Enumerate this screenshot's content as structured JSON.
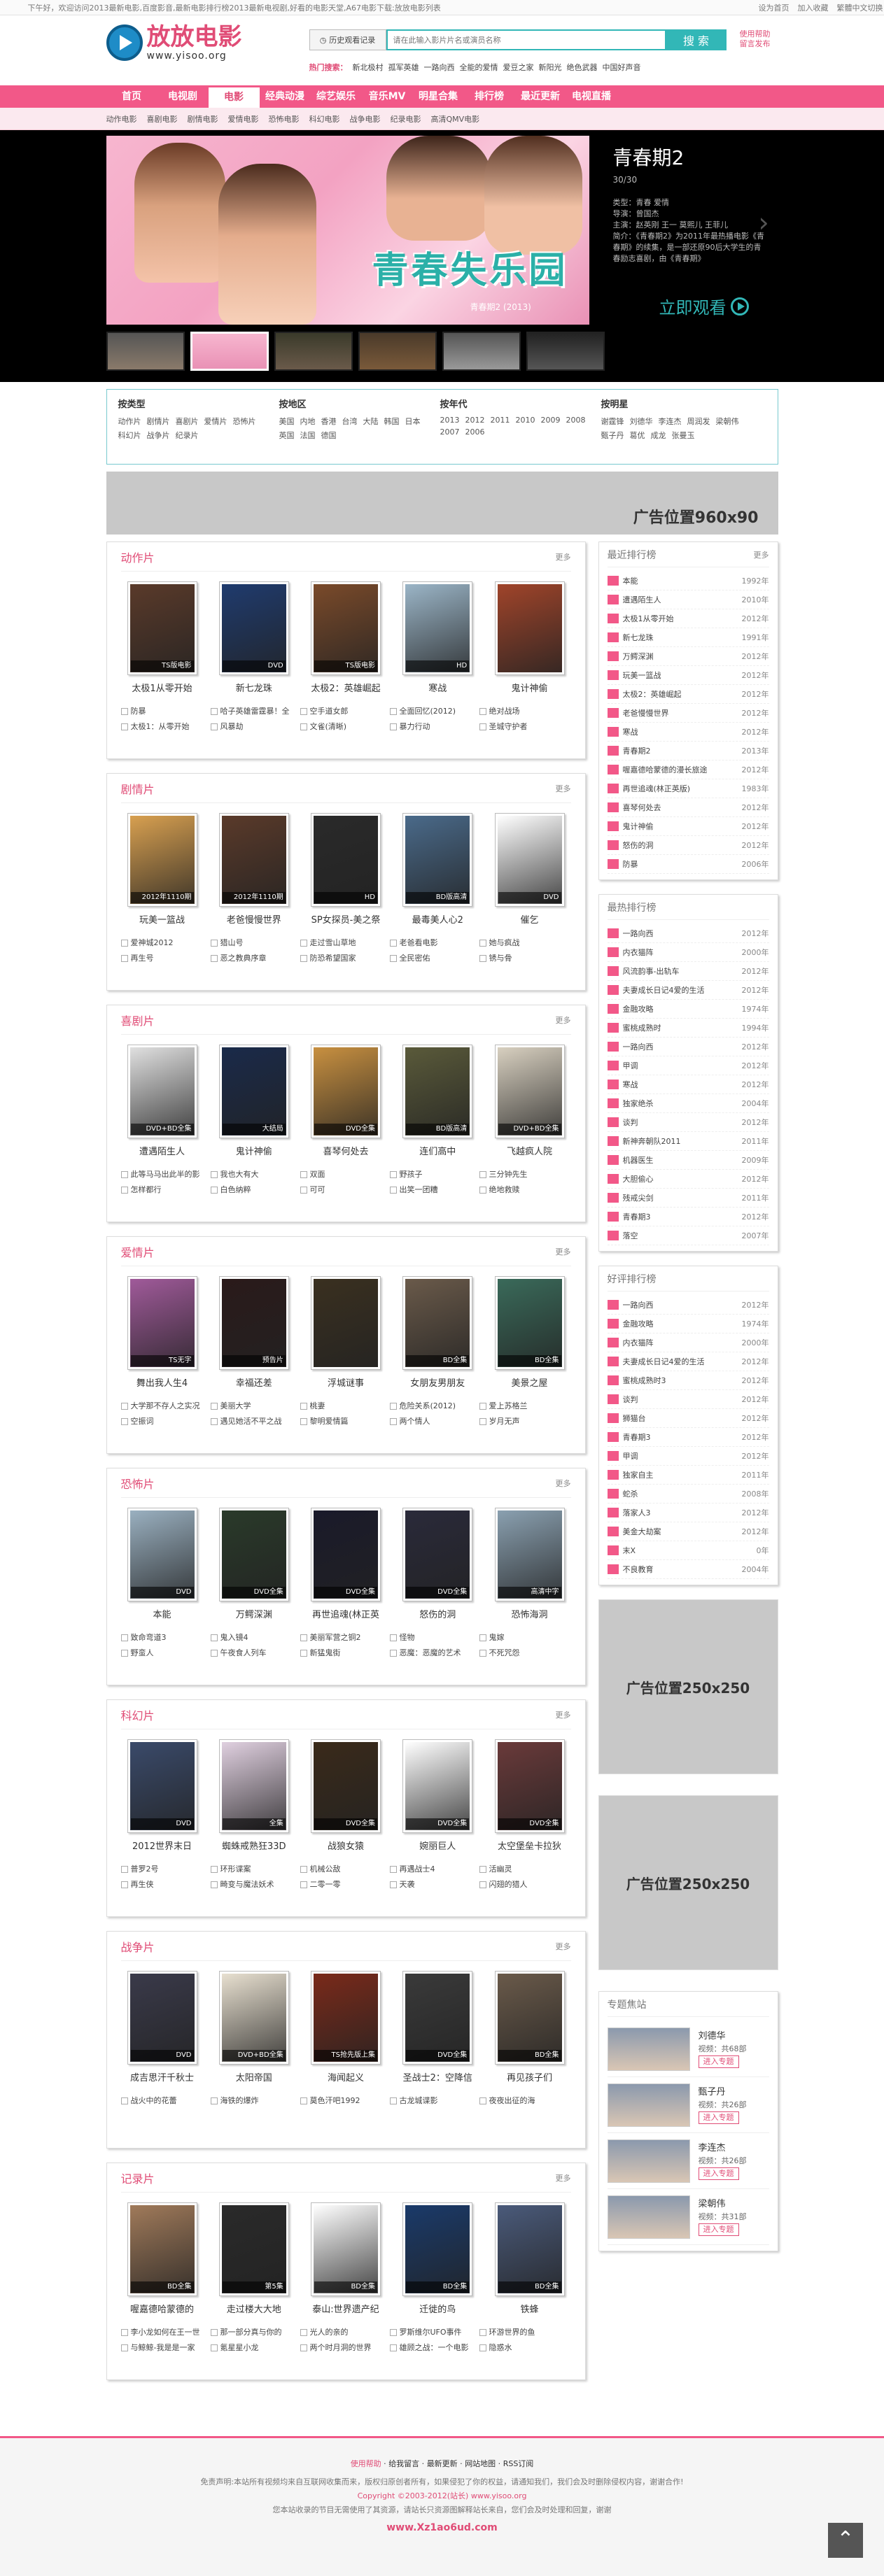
{
  "topbar": {
    "greeting": "下午好，欢迎访问2013最新电影,百度影音,最新电影排行榜2013最新电视剧,好看的电影天堂,A67电影下载:放放电影列表",
    "links": [
      "设为首页",
      "加入收藏",
      "繁體中文切换"
    ]
  },
  "header": {
    "logo_cn": "放放电影",
    "logo_en": "www.yisoo.org",
    "history_label": "历史观看记录",
    "search_placeholder": "请在此输入影片片名或演员名称",
    "search_button": "搜 索",
    "help": [
      "使用帮助",
      "留言发布"
    ],
    "hot_label": "热门搜索：",
    "hot": [
      "新北极村",
      "孤军英雄",
      "一路向西",
      "全能的爱情",
      "爱豆之家",
      "新阳光",
      "绝色武器",
      "中国好声音"
    ]
  },
  "nav": {
    "items": [
      "首页",
      "电视剧",
      "电影",
      "经典动漫",
      "综艺娱乐",
      "音乐MV",
      "明星合集",
      "排行榜",
      "最近更新",
      "电视直播"
    ],
    "active": 2,
    "sub": [
      "动作电影",
      "喜剧电影",
      "剧情电影",
      "爱情电影",
      "恐怖电影",
      "科幻电影",
      "战争电影",
      "纪录电影",
      "高清QMV电影"
    ]
  },
  "banner": {
    "title": "青春期2",
    "sub": "30/30",
    "lines": [
      "类型：青春 爱情",
      "导演：曾国杰",
      "主演：赵英刚 王一 莫熙儿 王菲儿",
      "简介：《青春期2》为2011年最热播电影《青春期》的续集，是一部还原90后大学生的青春励志喜剧，由《青春期》"
    ],
    "watch": "立即观看",
    "logo_text": "青春失乐园",
    "caption": "青春期2 (2013)"
  },
  "filter": {
    "cols": [
      {
        "title": "按类型",
        "opts": [
          "动作片",
          "剧情片",
          "喜剧片",
          "爱情片",
          "恐怖片",
          "科幻片",
          "战争片",
          "纪录片"
        ]
      },
      {
        "title": "按地区",
        "opts": [
          "美国",
          "内地",
          "香港",
          "台湾",
          "大陆",
          "韩国",
          "日本",
          "英国",
          "法国",
          "德国"
        ]
      },
      {
        "title": "按年代",
        "opts": [
          "2013",
          "2012",
          "2011",
          "2010",
          "2009",
          "2008",
          "2007",
          "2006"
        ]
      },
      {
        "title": "按明星",
        "opts": [
          "谢霆锋",
          "刘德华",
          "李连杰",
          "周润发",
          "梁朝伟",
          "甄子丹",
          "葛优",
          "成龙",
          "张曼玉"
        ]
      }
    ]
  },
  "ads": {
    "top": "广告位置960x90",
    "side1": "广告位置250x250",
    "side2": "广告位置250x250"
  },
  "sections": [
    {
      "title": "动作片",
      "more": "更多",
      "movies": [
        {
          "t": "太极1从零开始",
          "b": "TS版电影"
        },
        {
          "t": "新七龙珠",
          "b": "DVD"
        },
        {
          "t": "太极2：英雄崛起",
          "b": "TS版电影"
        },
        {
          "t": "寒战",
          "b": "HD"
        },
        {
          "t": "鬼计神偷",
          "b": ""
        }
      ],
      "links": [
        "防暴",
        "哈子英雄雷霆暴！全",
        "空手道女郎",
        "全面回忆(2012)",
        "绝对战场",
        "太极1：从零开始",
        "风暴劫",
        "文雀(清晰)",
        "暴力行动",
        "圣城守护者"
      ]
    },
    {
      "title": "剧情片",
      "more": "更多",
      "movies": [
        {
          "t": "玩美一篮战",
          "b": "2012年1110期"
        },
        {
          "t": "老爸慢慢世界",
          "b": "2012年1110期"
        },
        {
          "t": "SP女探员-美之祭",
          "b": "HD"
        },
        {
          "t": "最毒美人心2",
          "b": "BD版高清"
        },
        {
          "t": "催乞",
          "b": "DVD"
        }
      ],
      "links": [
        "爱神城2012",
        "猎山号",
        "走过雪山草地",
        "老爸看电影",
        "她与疯战",
        "再生号",
        "恶之教典序章",
        "防恐希望国家",
        "全民密佑",
        "锈与骨"
      ]
    },
    {
      "title": "喜剧片",
      "more": "更多",
      "movies": [
        {
          "t": "遭遇陌生人",
          "b": "DVD+BD全集"
        },
        {
          "t": "鬼计神偷",
          "b": "大结局"
        },
        {
          "t": "喜琴何处去",
          "b": "DVD全集"
        },
        {
          "t": "连们高中",
          "b": "BD版高清"
        },
        {
          "t": "飞越疯人院",
          "b": "DVD+BD全集"
        }
      ],
      "links": [
        "此等马马出此半的影",
        "我也大有大",
        "双面",
        "野孩子",
        "三分钟先生",
        "怎样都行",
        "白色纳粹",
        "可可",
        "出笑一团糟",
        "绝地救赎"
      ]
    },
    {
      "title": "爱情片",
      "more": "更多",
      "movies": [
        {
          "t": "舞出我人生4",
          "b": "TS无字"
        },
        {
          "t": "幸福还差",
          "b": "预告片"
        },
        {
          "t": "浮城谜事",
          "b": ""
        },
        {
          "t": "女朋友男朋友",
          "b": "BD全集"
        },
        {
          "t": "美景之屋",
          "b": "BD全集"
        }
      ],
      "links": [
        "大学那不存人之实况",
        "美丽大学",
        "桃妻",
        "危险关系(2012)",
        "爱上苏格兰",
        "空振词",
        "遇见她活不平之战",
        "黎明爱情篇",
        "两个情人",
        "岁月无声"
      ]
    },
    {
      "title": "恐怖片",
      "more": "更多",
      "movies": [
        {
          "t": "本能",
          "b": "DVD"
        },
        {
          "t": "万鳄深渊",
          "b": "DVD全集"
        },
        {
          "t": "再世追魂(林正英",
          "b": "DVD全集"
        },
        {
          "t": "怒伤的洞",
          "b": "DVD全集"
        },
        {
          "t": "恐怖海洞",
          "b": "高清中字"
        }
      ],
      "links": [
        "致命弯道3",
        "鬼入镜4",
        "美丽军营之铜2",
        "怪物",
        "鬼嫁",
        "野蛮人",
        "午夜食人列车",
        "新猛鬼街",
        "恶魔：恶魔的艺术",
        "不死咒怨"
      ]
    },
    {
      "title": "科幻片",
      "more": "更多",
      "movies": [
        {
          "t": "2012世界末日",
          "b": "DVD"
        },
        {
          "t": "蜘蛛戒熟狂33D",
          "b": "全集"
        },
        {
          "t": "战狼女猿",
          "b": "DVD全集"
        },
        {
          "t": "婉丽巨人",
          "b": "DVD全集"
        },
        {
          "t": "太空堡垒卡拉狄",
          "b": "DVD全集"
        }
      ],
      "links": [
        "普罗2号",
        "环形谍案",
        "机械公敌",
        "再遇战士4",
        "活幽灵",
        "再生侠",
        "畸变与魔法妖术",
        "二零一零",
        "天袭",
        "闪翅的猎人"
      ]
    },
    {
      "title": "战争片",
      "more": "更多",
      "movies": [
        {
          "t": "成吉思汗千秋士",
          "b": "DVD"
        },
        {
          "t": "太阳帝国",
          "b": "DVD+BD全集"
        },
        {
          "t": "海闻起义",
          "b": "TS抢先版上集"
        },
        {
          "t": "圣战士2：空降信",
          "b": "DVD全集"
        },
        {
          "t": "再见孩子们",
          "b": "BD全集"
        }
      ],
      "links": [
        "战火中的花蕾",
        "海铁的爆炸",
        "莫色汗吧1992",
        "古龙城谍影",
        "夜夜出征的海"
      ]
    },
    {
      "title": "记录片",
      "more": "更多",
      "movies": [
        {
          "t": "喔嘉德哈蒙德的",
          "b": "BD全集"
        },
        {
          "t": "走过楼大大地",
          "b": "第5集"
        },
        {
          "t": "泰山:世界遗产纪",
          "b": "BD全集"
        },
        {
          "t": "迁徙的鸟",
          "b": "BD全集"
        },
        {
          "t": "铁蜂",
          "b": "BD全集"
        }
      ],
      "links": [
        "李小龙如何在王一世",
        "那一部分真与你的",
        "光人的亲的",
        "罗斯维尔UFO事件",
        "环游世界的鱼",
        "与鲸鲸-我是是一家",
        "氪星星小龙",
        "两个时月洞的世界",
        "雄顾之战：一个电影",
        "隐惑水"
      ]
    }
  ],
  "poster_colors": [
    [
      "#5a3a2a",
      "#1f3b6e",
      "#7a4a2a",
      "#9bb5c7",
      "#a0442a"
    ],
    [
      "#d8a050",
      "#5a3a2a",
      "#2a2a2a",
      "#4a6a8a",
      "#ffffff"
    ],
    [
      "#e0e0e0",
      "#1a2a4a",
      "#c89040",
      "#5a5a3a",
      "#d8d0c0"
    ],
    [
      "#a05a9a",
      "#2a1a1a",
      "#3a3020",
      "#6a5a4a",
      "#3a6a5a"
    ],
    [
      "#9ab0c0",
      "#2a3a2a",
      "#1a1a2a",
      "#2a2a3a",
      "#8aa0b0"
    ],
    [
      "#3a4a6a",
      "#e0d0e0",
      "#3a2a1a",
      "#ffffff",
      "#6a3a3a"
    ],
    [
      "#3a3a4a",
      "#e8e0d0",
      "#7a2a1a",
      "#3a3a3a",
      "#6a5a4a"
    ],
    [
      "#a07a5a",
      "#2a2a2a",
      "#ffffff",
      "#1a3a6a",
      "#4a5a7a"
    ]
  ],
  "rank_recent": {
    "title": "最近排行榜",
    "more": "更多",
    "items": [
      [
        "本能",
        "1992年"
      ],
      [
        "遭遇陌生人",
        "2010年"
      ],
      [
        "太极1从零开始",
        "2012年"
      ],
      [
        "新七龙珠",
        "1991年"
      ],
      [
        "万鳄深渊",
        "2012年"
      ],
      [
        "玩美一篮战",
        "2012年"
      ],
      [
        "太极2：英雄崛起",
        "2012年"
      ],
      [
        "老爸慢慢世界",
        "2012年"
      ],
      [
        "寒战",
        "2012年"
      ],
      [
        "青春期2",
        "2013年"
      ],
      [
        "喔嘉德哈蒙德的漫长旅途",
        "2012年"
      ],
      [
        "再世追魂(林正英版)",
        "1983年"
      ],
      [
        "喜琴何处去",
        "2012年"
      ],
      [
        "鬼计神偷",
        "2012年"
      ],
      [
        "怒伤的洞",
        "2012年"
      ],
      [
        "防暴",
        "2006年"
      ]
    ]
  },
  "rank_hot": {
    "title": "最热排行榜",
    "items": [
      [
        "一路向西",
        "2012年"
      ],
      [
        "内衣猫阵",
        "2000年"
      ],
      [
        "风流韵事-出轨车",
        "2012年"
      ],
      [
        "夫妻成长日记4爱的生活",
        "2012年"
      ],
      [
        "金融攻略",
        "1974年"
      ],
      [
        "蜜桃成熟时",
        "1994年"
      ],
      [
        "一路向西",
        "2012年"
      ],
      [
        "甲调",
        "2012年"
      ],
      [
        "寒战",
        "2012年"
      ],
      [
        "独家绝杀",
        "2004年"
      ],
      [
        "谈判",
        "2012年"
      ],
      [
        "新神奔朝队2011",
        "2011年"
      ],
      [
        "机器医生",
        "2009年"
      ],
      [
        "大胆偷心",
        "2012年"
      ],
      [
        "残戒尖剑",
        "2011年"
      ],
      [
        "青春期3",
        "2012年"
      ],
      [
        "落空",
        "2007年"
      ]
    ]
  },
  "rank_good": {
    "title": "好评排行榜",
    "items": [
      [
        "一路向西",
        "2012年"
      ],
      [
        "金融攻略",
        "1974年"
      ],
      [
        "内衣猫阵",
        "2000年"
      ],
      [
        "夫妻成长日记4爱的生活",
        "2012年"
      ],
      [
        "蜜桃成熟时3",
        "2012年"
      ],
      [
        "谈判",
        "2012年"
      ],
      [
        "狮猫台",
        "2012年"
      ],
      [
        "青春期3",
        "2012年"
      ],
      [
        "甲调",
        "2012年"
      ],
      [
        "独家自主",
        "2011年"
      ],
      [
        "蛇杀",
        "2008年"
      ],
      [
        "落家人3",
        "2012年"
      ],
      [
        "美金大劫案",
        "2012年"
      ],
      [
        "末X",
        "0年"
      ],
      [
        "不良教育",
        "2004年"
      ]
    ]
  },
  "topics": {
    "title": "专题焦站",
    "items": [
      {
        "name": "刘德华",
        "count": "视频：共68部",
        "btn": "进入专题"
      },
      {
        "name": "甄子丹",
        "count": "视频：共26部",
        "btn": "进入专题"
      },
      {
        "name": "李连杰",
        "count": "视频：共26部",
        "btn": "进入专题"
      },
      {
        "name": "梁朝伟",
        "count": "视频：共31部",
        "btn": "进入专题"
      }
    ]
  },
  "footer": {
    "nav": [
      "使用帮助",
      "给我留言",
      "最新更新",
      "网站地图",
      "RSS订阅"
    ],
    "disclaimer": "免责声明:本站所有视频均来自互联网收集而来，版权归原创者所有，如果侵犯了你的权益，请通知我们，我们会及时删除侵权内容，谢谢合作!",
    "copyright": "Copyright ©2003-2012(站长) www.yisoo.org",
    "note": "您本站收录的节目无需使用了其资源，请站长只资源图解释站长来自，您们会及时处理和回复，谢谢",
    "domain": "www.Xz1ao6ud.com",
    "backtop": "⌃"
  }
}
